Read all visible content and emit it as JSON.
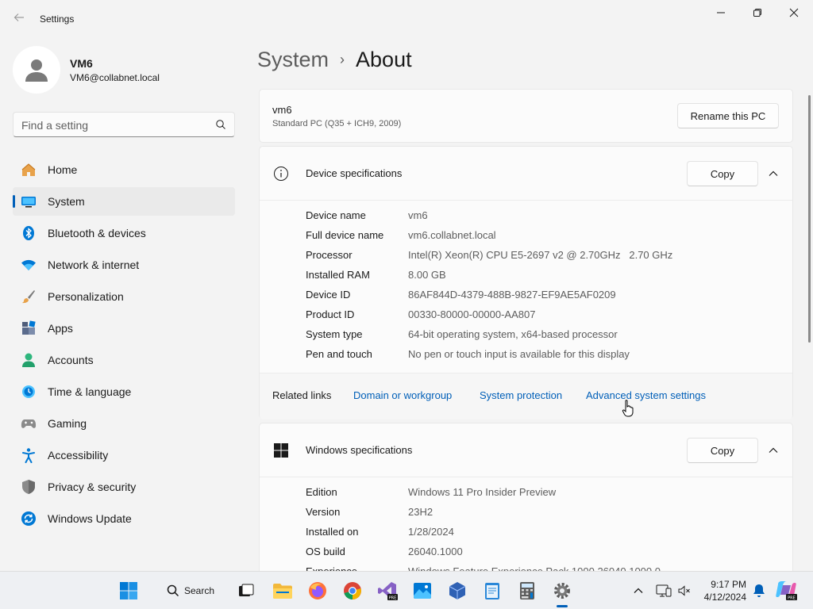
{
  "window": {
    "title": "Settings"
  },
  "profile": {
    "name": "VM6",
    "email": "VM6@collabnet.local"
  },
  "search": {
    "placeholder": "Find a setting"
  },
  "nav": {
    "items": [
      {
        "label": "Home",
        "icon": "home-icon"
      },
      {
        "label": "System",
        "icon": "system-icon",
        "active": true
      },
      {
        "label": "Bluetooth & devices",
        "icon": "bluetooth-icon"
      },
      {
        "label": "Network & internet",
        "icon": "wifi-icon"
      },
      {
        "label": "Personalization",
        "icon": "brush-icon"
      },
      {
        "label": "Apps",
        "icon": "apps-icon"
      },
      {
        "label": "Accounts",
        "icon": "accounts-icon"
      },
      {
        "label": "Time & language",
        "icon": "clock-globe-icon"
      },
      {
        "label": "Gaming",
        "icon": "gamepad-icon"
      },
      {
        "label": "Accessibility",
        "icon": "accessibility-icon"
      },
      {
        "label": "Privacy & security",
        "icon": "shield-icon"
      },
      {
        "label": "Windows Update",
        "icon": "update-icon"
      }
    ]
  },
  "breadcrumb": {
    "parent": "System",
    "separator": "›",
    "current": "About"
  },
  "pc": {
    "name": "vm6",
    "model": "Standard PC (Q35 + ICH9, 2009)",
    "rename_label": "Rename this PC"
  },
  "device_specs": {
    "title": "Device specifications",
    "copy_label": "Copy",
    "rows": [
      {
        "label": "Device name",
        "value": "vm6"
      },
      {
        "label": "Full device name",
        "value": "vm6.collabnet.local"
      },
      {
        "label": "Processor",
        "value": "Intel(R) Xeon(R) CPU E5-2697 v2 @ 2.70GHz   2.70 GHz"
      },
      {
        "label": "Installed RAM",
        "value": "8.00 GB"
      },
      {
        "label": "Device ID",
        "value": "86AF844D-4379-488B-9827-EF9AE5AF0209"
      },
      {
        "label": "Product ID",
        "value": "00330-80000-00000-AA807"
      },
      {
        "label": "System type",
        "value": "64-bit operating system, x64-based processor"
      },
      {
        "label": "Pen and touch",
        "value": "No pen or touch input is available for this display"
      }
    ]
  },
  "related": {
    "label": "Related links",
    "links": [
      "Domain or workgroup",
      "System protection",
      "Advanced system settings"
    ]
  },
  "windows_specs": {
    "title": "Windows specifications",
    "copy_label": "Copy",
    "rows": [
      {
        "label": "Edition",
        "value": "Windows 11 Pro Insider Preview"
      },
      {
        "label": "Version",
        "value": "23H2"
      },
      {
        "label": "Installed on",
        "value": "1/28/2024"
      },
      {
        "label": "OS build",
        "value": "26040.1000"
      },
      {
        "label": "Experience",
        "value": "Windows Feature Experience Pack 1000.26040.1000.0"
      }
    ]
  },
  "taskbar": {
    "search_label": "Search",
    "time": "9:17 PM",
    "date": "4/12/2024"
  },
  "colors": {
    "accent": "#005fb8",
    "background": "#f3f3f3",
    "card": "#fbfbfb"
  }
}
